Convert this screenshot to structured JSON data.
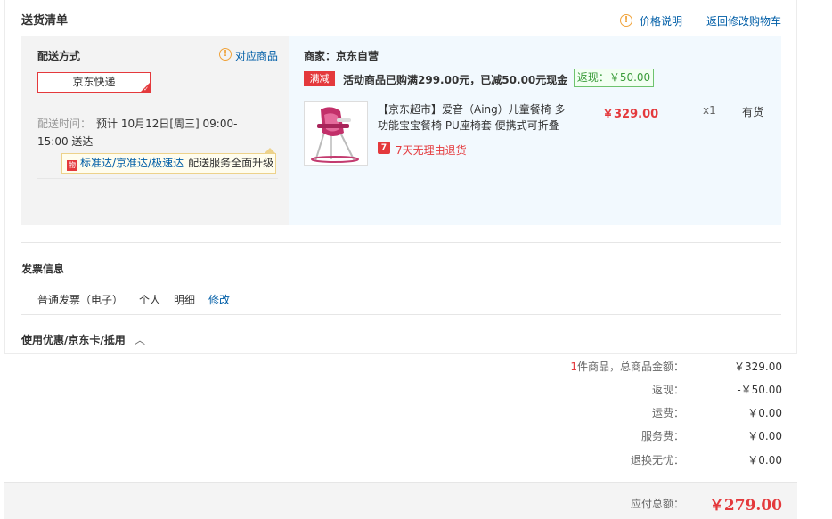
{
  "header": {
    "title": "送货清单",
    "price_note": "价格说明",
    "back_to_cart": "返回修改购物车"
  },
  "shipping": {
    "label": "配送方式",
    "match_goods": "对应商品",
    "method": "京东快递",
    "time_label": "配送时间：",
    "time_line1": "预计 10月12日[周三] 09:00-",
    "time_line2": "15:00 送达",
    "tip_icon": "jd-badge-icon",
    "tip_link": "标准达/京准达/极速达",
    "tip_text": "配送服务全面升级"
  },
  "goods": {
    "merchant": "商家：京东自营",
    "promo_badge": "满减",
    "promo_text": "活动商品已购满299.00元，已减50.00元现金",
    "cashback": "返现：￥50.00",
    "product_name_line1": "【京东超市】爱音（Aing）儿童餐椅 多",
    "product_name_line2": "功能宝宝餐椅 PU座椅套 便携式可折叠",
    "price": "￥329.00",
    "qty": "x1",
    "stock": "有货",
    "return_icon": "7",
    "return_text": "7天无理由退货"
  },
  "invoice": {
    "label": "发票信息",
    "type": "普通发票（电子）",
    "owner": "个人",
    "content": "明细",
    "edit": "修改"
  },
  "coupon": {
    "label": "使用优惠/京东卡/抵用"
  },
  "summary": {
    "count": "1",
    "count_suffix": "件商品，总商品金额：",
    "goods_total": "￥329.00",
    "cashback_label": "返现：",
    "cashback_value": "-￥50.00",
    "freight_label": "运费：",
    "freight_value": "￥0.00",
    "service_label": "服务费：",
    "service_value": "￥0.00",
    "worry_free_label": "退换无忧：",
    "worry_free_value": "￥0.00",
    "payable_label": "应付总额：",
    "payable_value": "￥279.00"
  },
  "colors": {
    "accent_red": "#e4393c",
    "link_blue": "#005ea7",
    "cashback_green": "#3b9c3b",
    "warn_orange": "#f0a33b"
  }
}
